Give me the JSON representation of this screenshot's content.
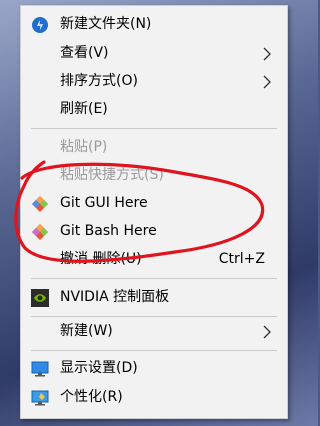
{
  "menu": {
    "items": [
      {
        "label": "新建文件夹(N)",
        "icon": "new-folder-icon"
      },
      {
        "label": "查看(V)",
        "submenu": true
      },
      {
        "label": "排序方式(O)",
        "submenu": true
      },
      {
        "label": "刷新(E)"
      },
      {
        "label": "粘贴(P)",
        "disabled": true
      },
      {
        "label": "粘贴快捷方式(S)",
        "disabled": true
      },
      {
        "label": "Git GUI Here",
        "icon": "git-gui-icon"
      },
      {
        "label": "Git Bash Here",
        "icon": "git-bash-icon"
      },
      {
        "label": "撤消 删除(U)",
        "shortcut": "Ctrl+Z"
      },
      {
        "label": "NVIDIA 控制面板",
        "icon": "nvidia-icon"
      },
      {
        "label": "新建(W)",
        "submenu": true
      },
      {
        "label": "显示设置(D)",
        "icon": "display-settings-icon"
      },
      {
        "label": "个性化(R)",
        "icon": "personalize-icon"
      }
    ]
  },
  "colors": {
    "menu_bg": "#f2f2f2",
    "disabled_text": "#9a9a9a",
    "annotation": "#e0141e"
  }
}
